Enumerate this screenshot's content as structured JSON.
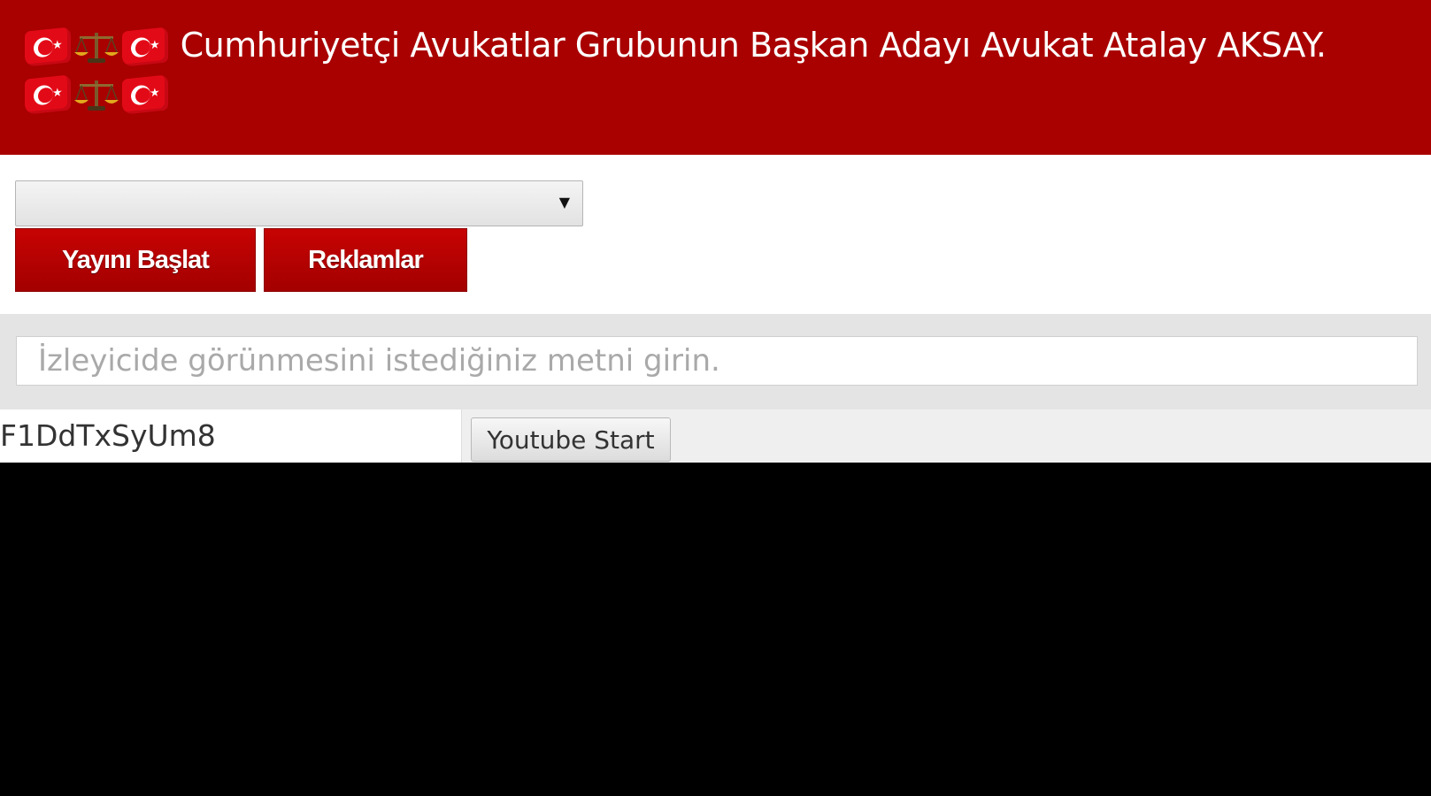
{
  "header": {
    "title_text": "Cumhuriyetçi Avukatlar Grubunun Başkan Adayı Avukat Atalay AKSAY.",
    "emoji_icons": [
      "turkish-flag-icon",
      "scales-of-justice-icon"
    ],
    "background_color": "#a90000"
  },
  "controls": {
    "dropdown_selected": "",
    "start_broadcast_label": "Yayını Başlat",
    "ads_label": "Reklamlar",
    "button_color": "#b80000"
  },
  "message": {
    "placeholder": "İzleyicide görünmesini istediğiniz metni girin.",
    "value": ""
  },
  "youtube": {
    "video_id": "F1DdTxSyUm8",
    "start_label": "Youtube Start"
  }
}
